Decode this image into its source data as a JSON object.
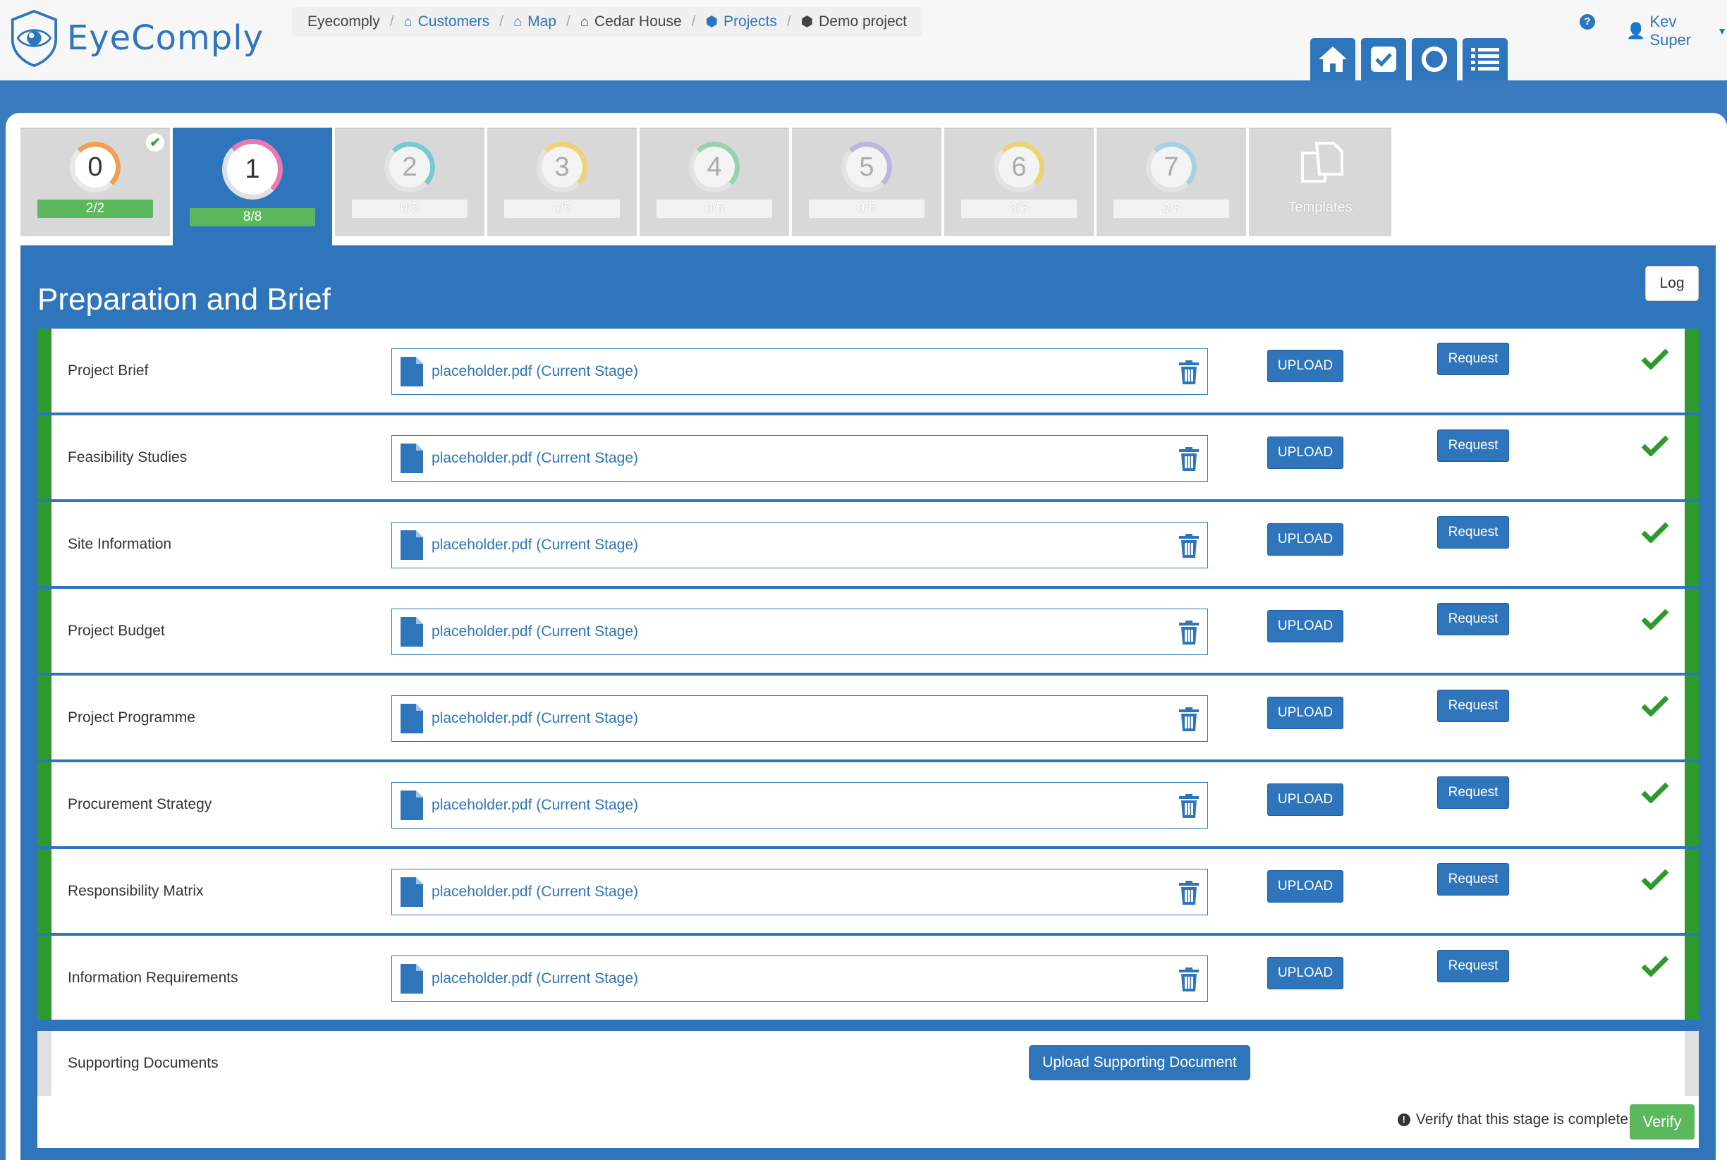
{
  "app": {
    "logo_text": "EyeComply"
  },
  "breadcrumb": [
    {
      "label": "Eyecomply",
      "icon": "",
      "link": false
    },
    {
      "label": "Customers",
      "icon": "home-icon",
      "link": true
    },
    {
      "label": "Map",
      "icon": "home-icon",
      "link": true
    },
    {
      "label": "Cedar House",
      "icon": "home-icon",
      "link": false
    },
    {
      "label": "Projects",
      "icon": "cubes-icon",
      "link": true
    },
    {
      "label": "Demo project",
      "icon": "cubes-icon",
      "link": false
    }
  ],
  "user": {
    "name": "Kev Super"
  },
  "nav_buttons": [
    "home-icon",
    "check-square-icon",
    "circle-icon",
    "list-icon"
  ],
  "stages": [
    {
      "number": "0",
      "progress": "2/2",
      "complete": true,
      "ring": "#f0a050"
    },
    {
      "number": "1",
      "progress": "8/8",
      "complete": true,
      "active": true,
      "ring": "#e87ab0"
    },
    {
      "number": "2",
      "progress": "0/5",
      "ring": "#4fc3d0"
    },
    {
      "number": "3",
      "progress": "0/5",
      "ring": "#f5d34a"
    },
    {
      "number": "4",
      "progress": "0/5",
      "ring": "#7dcf9a"
    },
    {
      "number": "5",
      "progress": "0/5",
      "ring": "#b4a7e0"
    },
    {
      "number": "6",
      "progress": "0/3",
      "ring": "#f5d34a"
    },
    {
      "number": "7",
      "progress": "0/3",
      "ring": "#8fd0e8"
    }
  ],
  "templates_tab": {
    "label": "Templates"
  },
  "stage": {
    "title": "Preparation and Brief",
    "log_label": "Log",
    "documents": [
      {
        "label": "Project Brief",
        "file": "placeholder.pdf (Current Stage)"
      },
      {
        "label": "Feasibility Studies",
        "file": "placeholder.pdf (Current Stage)"
      },
      {
        "label": "Site Information",
        "file": "placeholder.pdf (Current Stage)"
      },
      {
        "label": "Project Budget",
        "file": "placeholder.pdf (Current Stage)"
      },
      {
        "label": "Project Programme",
        "file": "placeholder.pdf (Current Stage)"
      },
      {
        "label": "Procurement Strategy",
        "file": "placeholder.pdf (Current Stage)"
      },
      {
        "label": "Responsibility Matrix",
        "file": "placeholder.pdf (Current Stage)"
      },
      {
        "label": "Information Requirements",
        "file": "placeholder.pdf (Current Stage)"
      }
    ],
    "upload_label": "UPLOAD",
    "request_label": "Request",
    "supporting_label": "Supporting Documents",
    "supporting_button": "Upload Supporting Document",
    "verify_text": "Verify that this stage is complete",
    "verify_button": "Verify"
  },
  "colors": {
    "primary": "#2e75bb",
    "success": "#5cb85c",
    "row_border": "#2e9a2e"
  }
}
